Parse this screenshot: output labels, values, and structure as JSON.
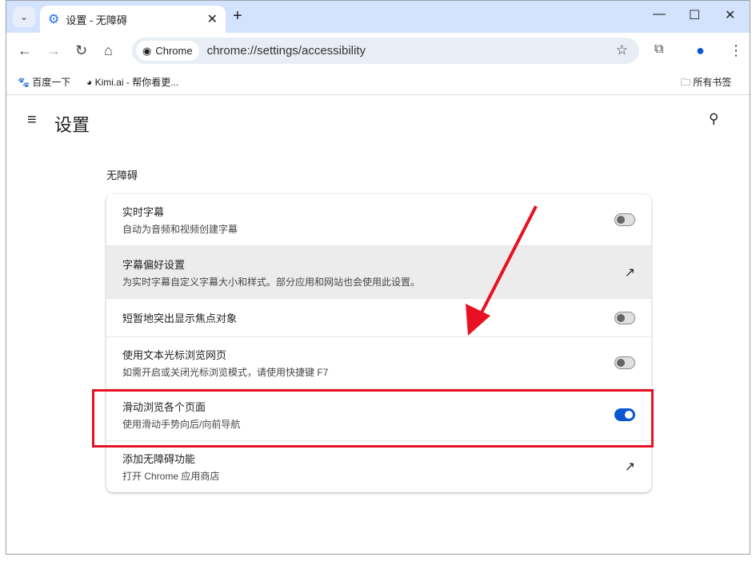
{
  "tab": {
    "title": "设置 - 无障碍"
  },
  "omnibox": {
    "chip": "Chrome",
    "url": "chrome://settings/accessibility"
  },
  "bookmarks": [
    {
      "label": "百度一下"
    },
    {
      "label": "Kimi.ai - 帮你看更..."
    }
  ],
  "bookmarks_all": "所有书签",
  "page": {
    "title": "设置",
    "section": "无障碍"
  },
  "rows": [
    {
      "title": "实时字幕",
      "sub": "自动为音频和视频创建字幕",
      "control": "toggle",
      "on": false
    },
    {
      "title": "字幕偏好设置",
      "sub": "为实时字幕自定义字幕大小和样式。部分应用和网站也会使用此设置。",
      "control": "external"
    },
    {
      "title": "短暂地突出显示焦点对象",
      "control": "toggle",
      "on": false
    },
    {
      "title": "使用文本光标浏览网页",
      "sub": "如需开启或关闭光标浏览模式，请使用快捷键 F7",
      "control": "toggle",
      "on": false
    },
    {
      "title": "滑动浏览各个页面",
      "sub": "使用滑动手势向后/向前导航",
      "control": "toggle",
      "on": true
    },
    {
      "title": "添加无障碍功能",
      "sub": "打开 Chrome 应用商店",
      "control": "external"
    }
  ],
  "colors": {
    "accent": "#0b57d0",
    "annotation": "#e81123"
  }
}
